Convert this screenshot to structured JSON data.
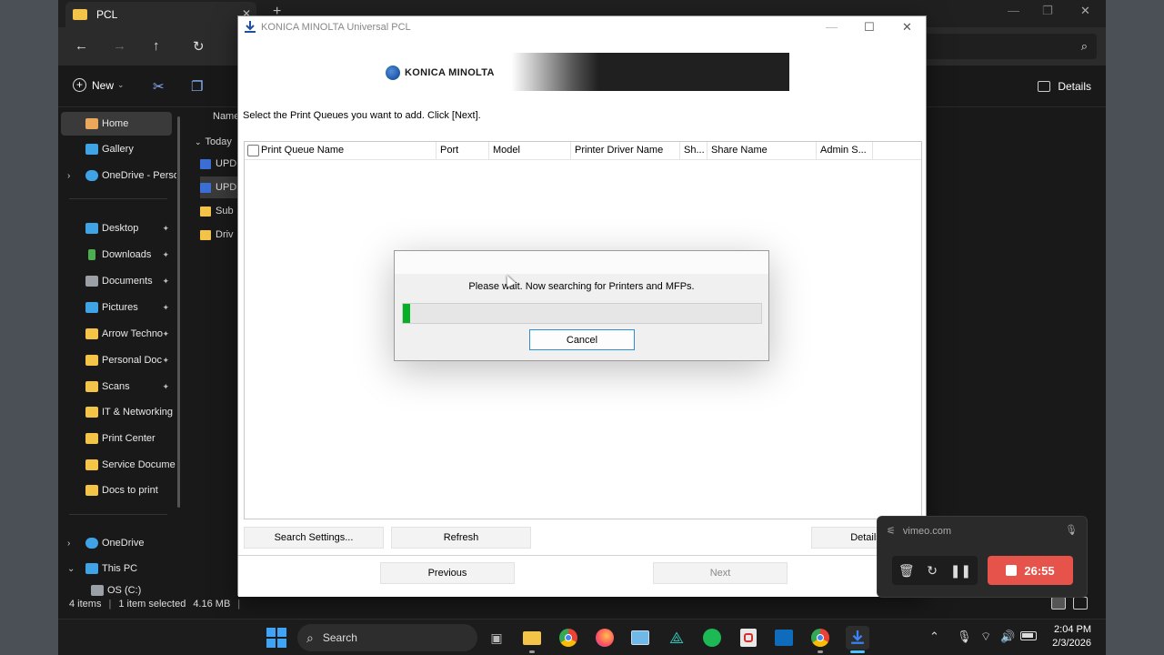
{
  "explorer": {
    "tab_title": "PCL",
    "new_label": "New",
    "details_label": "Details",
    "sidebar": [
      {
        "label": "Home",
        "icon": "home-icon",
        "color": "#e9a85b"
      },
      {
        "label": "Gallery",
        "icon": "gallery-icon",
        "color": "#3fa3e6"
      },
      {
        "label": "OneDrive - Perso",
        "icon": "cloud-icon",
        "color": "#3fa3e6"
      },
      {
        "label": "Desktop",
        "icon": "desktop-icon",
        "color": "#3fa3e6"
      },
      {
        "label": "Downloads",
        "icon": "download-icon",
        "color": "#4caf50"
      },
      {
        "label": "Documents",
        "icon": "document-icon",
        "color": "#9aa0a6"
      },
      {
        "label": "Pictures",
        "icon": "pictures-icon",
        "color": "#3fa3e6"
      },
      {
        "label": "Arrow Techno",
        "icon": "folder-icon",
        "color": "#f3c447"
      },
      {
        "label": "Personal Doc",
        "icon": "folder-icon",
        "color": "#f3c447"
      },
      {
        "label": "Scans",
        "icon": "folder-icon",
        "color": "#f3c447"
      },
      {
        "label": "IT & Networking",
        "icon": "folder-icon",
        "color": "#f3c447"
      },
      {
        "label": "Print Center",
        "icon": "folder-icon",
        "color": "#f3c447"
      },
      {
        "label": "Service Docume",
        "icon": "folder-icon",
        "color": "#f3c447"
      },
      {
        "label": "Docs to print",
        "icon": "folder-icon",
        "color": "#f3c447"
      },
      {
        "label": "OneDrive",
        "icon": "cloud-icon",
        "color": "#3fa3e6"
      },
      {
        "label": "This PC",
        "icon": "pc-icon",
        "color": "#3fa3e6"
      },
      {
        "label": "OS (C:)",
        "icon": "drive-icon",
        "color": "#9aa0a6"
      }
    ],
    "column_name": "Name",
    "group_today": "Today",
    "files": [
      {
        "label": "UPD",
        "color": "#3b6fd6"
      },
      {
        "label": "UPD",
        "color": "#3b6fd6"
      },
      {
        "label": "Sub",
        "color": "#f3c447"
      },
      {
        "label": "Driv",
        "color": "#f3c447"
      }
    ],
    "status": {
      "items": "4 items",
      "selected": "1 item selected",
      "size": "4.16 MB"
    }
  },
  "installer": {
    "title": "KONICA MINOLTA Universal PCL",
    "logo_text": "KONICA MINOLTA",
    "instruction": "Select the Print Queues you want to add. Click [Next].",
    "columns": [
      "Print Queue Name",
      "Port",
      "Model",
      "Printer Driver Name",
      "Sh...",
      "Share Name",
      "Admin S..."
    ],
    "buttons": {
      "search_settings": "Search Settings...",
      "refresh": "Refresh",
      "details": "Details",
      "previous": "Previous",
      "next": "Next"
    }
  },
  "progress_dialog": {
    "message": "Please wait. Now searching for Printers and MFPs.",
    "progress_fraction": 0.02,
    "cancel": "Cancel",
    "bar_color": "#06b025"
  },
  "vimeo": {
    "domain": "vimeo.com",
    "timer": "26:55",
    "accent": "#e5534b"
  },
  "taskbar": {
    "search_label": "Search",
    "time": "2:04 PM",
    "date": "2/3/2026"
  }
}
